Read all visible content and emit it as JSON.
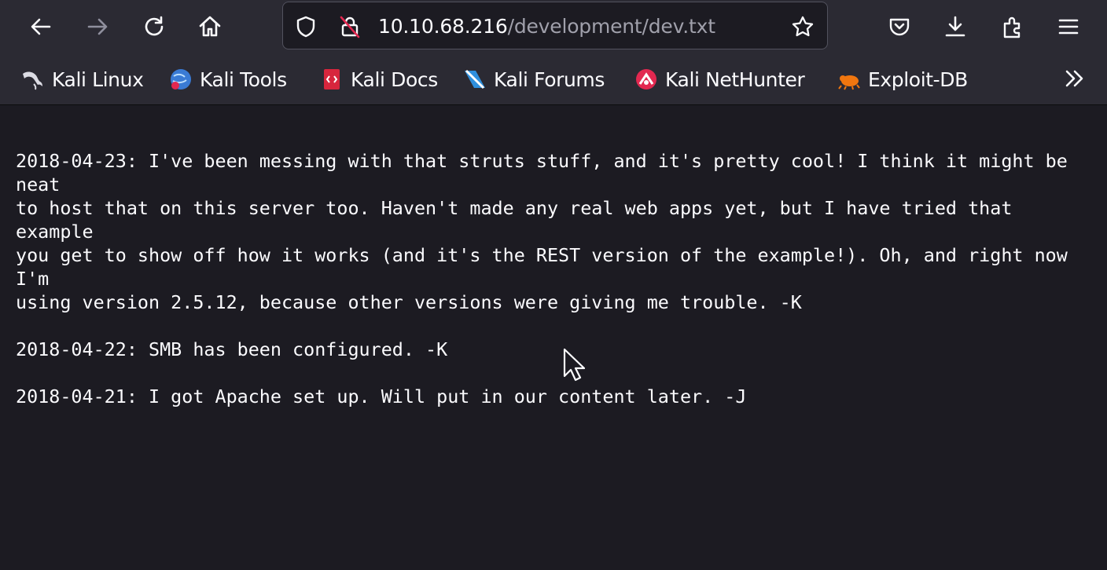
{
  "browser": {
    "url_host": "10.10.68.216",
    "url_path": "/development/dev.txt",
    "toolbar_icons": [
      "back-icon",
      "forward-icon",
      "reload-icon",
      "home-icon",
      "shield-icon",
      "insecure-lock-icon",
      "star-icon",
      "pocket-icon",
      "download-icon",
      "extensions-icon",
      "menu-icon"
    ]
  },
  "bookmarks": {
    "items": [
      {
        "label": "Kali Linux",
        "icon": "kali-dragon-icon"
      },
      {
        "label": "Kali Tools",
        "icon": "kali-tools-icon"
      },
      {
        "label": "Kali Docs",
        "icon": "kali-docs-icon"
      },
      {
        "label": "Kali Forums",
        "icon": "kali-forums-icon"
      },
      {
        "label": "Kali NetHunter",
        "icon": "kali-nethunter-icon"
      },
      {
        "label": "Exploit-DB",
        "icon": "exploit-db-icon"
      }
    ],
    "overflow_icon": "chevrons-right-icon"
  },
  "document": {
    "lines": [
      "2018-04-23: I've been messing with that struts stuff, and it's pretty cool! I think it might be",
      "neat",
      "to host that on this server too. Haven't made any real web apps yet, but I have tried that",
      "example",
      "you get to show off how it works (and it's the REST version of the example!). Oh, and right now",
      "I'm",
      "using version 2.5.12, because other versions were giving me trouble. -K",
      "",
      "2018-04-22: SMB has been configured. -K",
      "",
      "2018-04-21: I got Apache set up. Will put in our content later. -J"
    ]
  },
  "colors": {
    "toolbar_bg": "#2b2a33",
    "page_bg": "#1c1b22",
    "text": "#fbfbfe",
    "url_path": "#a0a0ab",
    "insecure_red": "#e22850"
  }
}
